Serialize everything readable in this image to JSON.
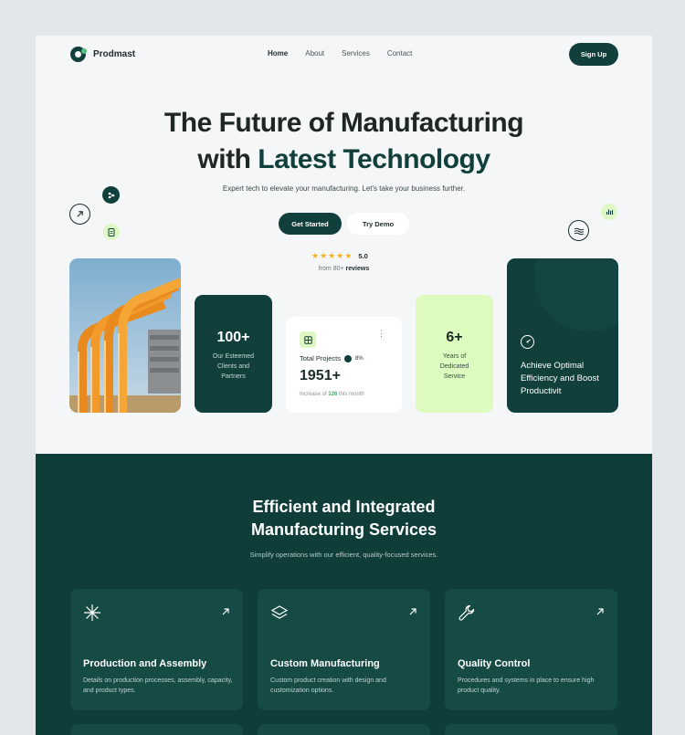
{
  "nav": {
    "brand": "Prodmast",
    "menu": [
      "Home",
      "About",
      "Services",
      "Contact"
    ],
    "active": "Home",
    "signup_label": "Sign Up"
  },
  "hero": {
    "title_line1": "The Future of Manufacturing",
    "title_line2_prefix": "with ",
    "title_line2_accent": "Latest Technology",
    "subtitle": "Expert tech to elevate your manufacturing. Let's take your business further.",
    "primary_button": "Get Started",
    "secondary_button": "Try Demo",
    "rating_value": "5.0",
    "rating_stars": 5,
    "rating_from": "from 80+",
    "rating_reviews": "reviews"
  },
  "stats": {
    "clients": {
      "number": "100+",
      "label": "Our Esteemed Clients and Partners"
    },
    "projects": {
      "label": "Total Projects",
      "percent": "8%",
      "number": "1951+",
      "note_prefix": "Increase of",
      "note_value": "126",
      "note_suffix": "this month"
    },
    "years": {
      "number": "6+",
      "label": "Years of Dedicated Service"
    },
    "optimal": {
      "text": "Achieve Optimal Efficiency and Boost Productivit"
    }
  },
  "services": {
    "title_line1": "Efficient and Integrated",
    "title_line2": "Manufacturing Services",
    "subtitle": "Simplify operations with our efficient, quality-focused services.",
    "items": [
      {
        "icon": "asterisk-icon",
        "title": "Production and Assembly",
        "description": "Details on production processes, assembly, capacity, and product types."
      },
      {
        "icon": "layers-icon",
        "title": "Custom Manufacturing",
        "description": "Custom product creation with design and customization options."
      },
      {
        "icon": "wrench-icon",
        "title": "Quality Control",
        "description": "Procedures and systems in place to ensure high product quality."
      }
    ]
  },
  "colors": {
    "brand_dark": "#11403c",
    "accent_lime": "#ddfbbf",
    "star": "#f5b21b",
    "highlight_green": "#3eb06a"
  }
}
